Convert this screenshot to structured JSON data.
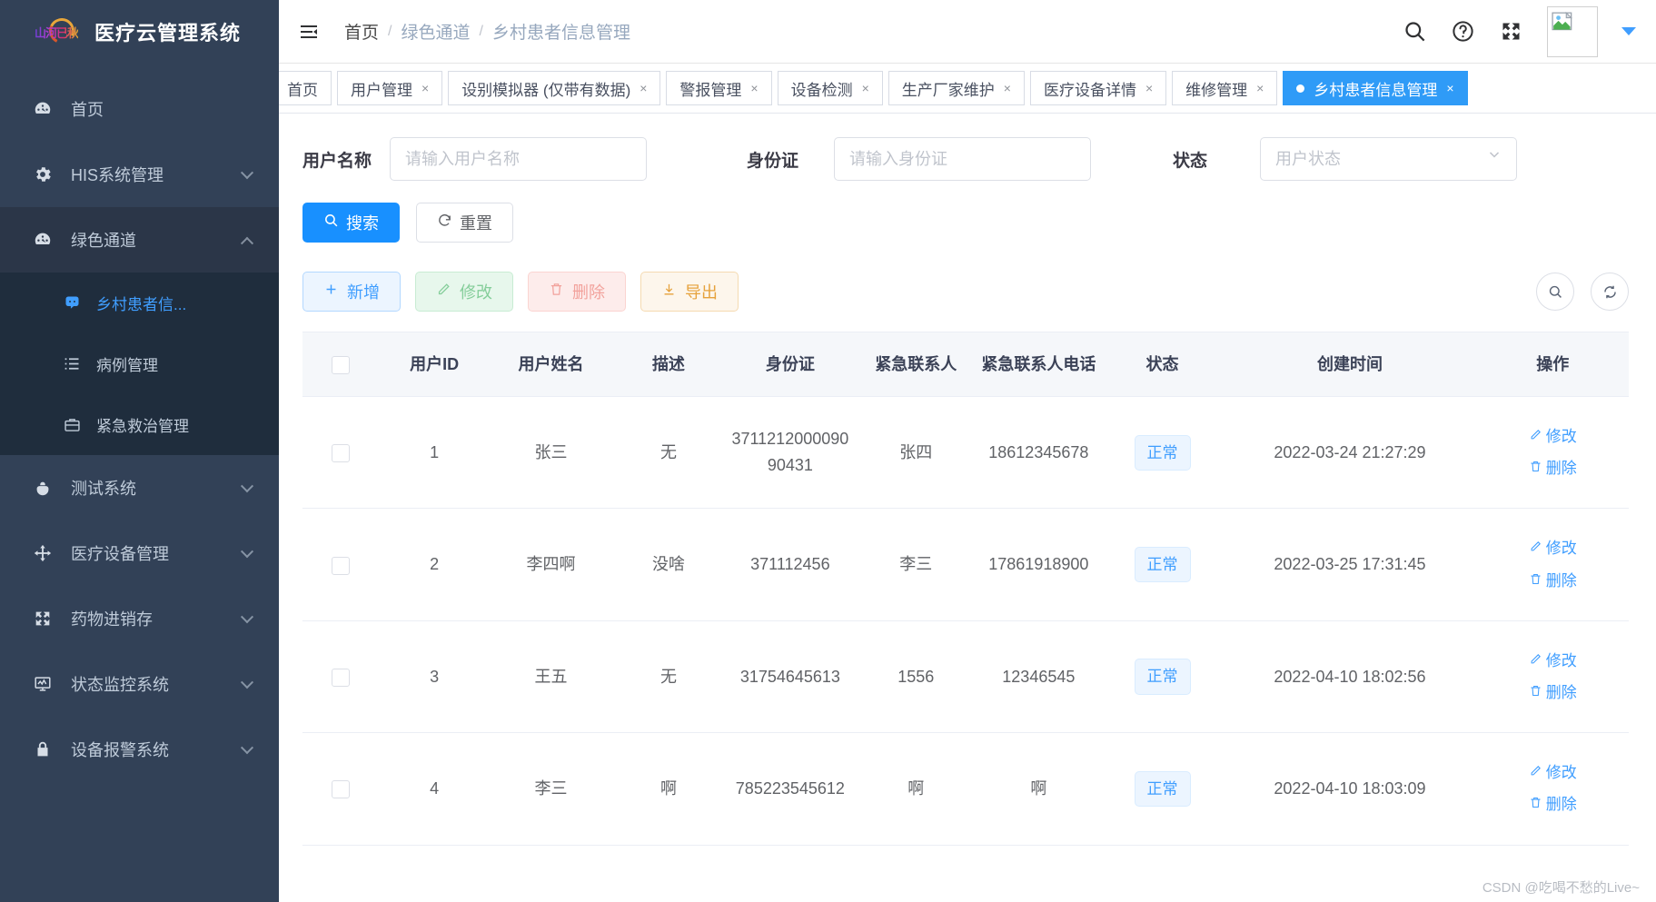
{
  "sidebar": {
    "logo_scribble": "山河已秋",
    "title": "医疗云管理系统",
    "items": [
      {
        "label": "首页",
        "icon": "dashboard-icon",
        "arrow": ""
      },
      {
        "label": "HIS系统管理",
        "icon": "gear-icon",
        "arrow": "down"
      },
      {
        "label": "绿色通道",
        "icon": "dashboard-icon",
        "arrow": "up"
      }
    ],
    "submenu": [
      {
        "label": "乡村患者信...",
        "icon": "user-face-icon",
        "selected": true
      },
      {
        "label": "病例管理",
        "icon": "list-icon",
        "selected": false
      },
      {
        "label": "紧急救治管理",
        "icon": "briefcase-icon",
        "selected": false
      }
    ],
    "items_after": [
      {
        "label": "测试系统",
        "icon": "bug-icon",
        "arrow": "down"
      },
      {
        "label": "医疗设备管理",
        "icon": "move-icon",
        "arrow": "down"
      },
      {
        "label": "药物进销存",
        "icon": "expand-icon",
        "arrow": "down"
      },
      {
        "label": "状态监控系统",
        "icon": "monitor-icon",
        "arrow": "down"
      },
      {
        "label": "设备报警系统",
        "icon": "lock-icon",
        "arrow": "down"
      }
    ]
  },
  "topbar": {
    "menu_toggle": "hamburger-icon",
    "breadcrumb": [
      "首页",
      "绿色通道",
      "乡村患者信息管理"
    ],
    "separator": "/",
    "actions": [
      "search-icon",
      "help-icon",
      "fullscreen-icon"
    ],
    "avatar_alt": "broken-image"
  },
  "tabs": [
    {
      "label": "首页",
      "closable": false,
      "active": false
    },
    {
      "label": "用户管理",
      "closable": true,
      "active": false
    },
    {
      "label": "设别模拟器 (仅带有数据)",
      "closable": true,
      "active": false
    },
    {
      "label": "警报管理",
      "closable": true,
      "active": false
    },
    {
      "label": "设备检测",
      "closable": true,
      "active": false
    },
    {
      "label": "生产厂家维护",
      "closable": true,
      "active": false
    },
    {
      "label": "医疗设备详情",
      "closable": true,
      "active": false
    },
    {
      "label": "维修管理",
      "closable": true,
      "active": false
    },
    {
      "label": "乡村患者信息管理",
      "closable": true,
      "active": true
    }
  ],
  "tab_close_glyph": "×",
  "filters": [
    {
      "label": "用户名称",
      "placeholder": "请输入用户名称",
      "value": "",
      "type": "text",
      "name": "username"
    },
    {
      "label": "身份证",
      "placeholder": "请输入身份证",
      "value": "",
      "type": "text",
      "name": "idcard"
    },
    {
      "label": "状态",
      "placeholder": "用户状态",
      "value": "",
      "type": "select",
      "name": "status"
    }
  ],
  "buttons": {
    "search": "搜索",
    "reset": "重置"
  },
  "operations": [
    {
      "label": "新增",
      "icon": "plus-icon",
      "style": "add"
    },
    {
      "label": "修改",
      "icon": "pencil-icon",
      "style": "edit"
    },
    {
      "label": "删除",
      "icon": "trash-icon",
      "style": "delete"
    },
    {
      "label": "导出",
      "icon": "download-icon",
      "style": "export"
    }
  ],
  "right_tools": [
    {
      "icon": "search-circle-icon"
    },
    {
      "icon": "refresh-circle-icon"
    }
  ],
  "table": {
    "columns": [
      {
        "key": "checkbox",
        "label": "",
        "cls": "col-cb"
      },
      {
        "key": "id",
        "label": "用户ID",
        "cls": "col-id"
      },
      {
        "key": "name",
        "label": "用户姓名",
        "cls": "col-name"
      },
      {
        "key": "desc",
        "label": "描述",
        "cls": "col-desc"
      },
      {
        "key": "idcard",
        "label": "身份证",
        "cls": "col-idcard"
      },
      {
        "key": "contact",
        "label": "紧急联系人",
        "cls": "col-ec"
      },
      {
        "key": "contact_phone",
        "label": "紧急联系人电话",
        "cls": "col-ecp"
      },
      {
        "key": "status",
        "label": "状态",
        "cls": "col-status"
      },
      {
        "key": "created",
        "label": "创建时间",
        "cls": "col-time"
      },
      {
        "key": "actions",
        "label": "操作",
        "cls": "col-op"
      }
    ],
    "rows": [
      {
        "id": "1",
        "name": "张三",
        "desc": "无",
        "idcard": "371121200009090431",
        "contact": "张四",
        "contact_phone": "18612345678",
        "status": "正常",
        "created": "2022-03-24 21:27:29",
        "edit": "修改",
        "delete": "删除"
      },
      {
        "id": "2",
        "name": "李四啊",
        "desc": "没啥",
        "idcard": "371112456",
        "contact": "李三",
        "contact_phone": "17861918900",
        "status": "正常",
        "created": "2022-03-25 17:31:45",
        "edit": "修改",
        "delete": "删除"
      },
      {
        "id": "3",
        "name": "王五",
        "desc": "无",
        "idcard": "31754645613",
        "contact": "1556",
        "contact_phone": "12346545",
        "status": "正常",
        "created": "2022-04-10 18:02:56",
        "edit": "修改",
        "delete": "删除"
      },
      {
        "id": "4",
        "name": "李三",
        "desc": "啊",
        "idcard": "785223545612",
        "contact": "啊",
        "contact_phone": "啊",
        "status": "正常",
        "created": "2022-04-10 18:03:09",
        "edit": "修改",
        "delete": "删除"
      }
    ]
  },
  "watermark": "CSDN @吃喝不愁的Live~",
  "colors": {
    "sidebar_bg": "#324157",
    "submenu_bg": "#1f2d3d",
    "accent": "#409eff",
    "tab_active": "#2f9bf7",
    "primary_btn": "#1890ff"
  }
}
